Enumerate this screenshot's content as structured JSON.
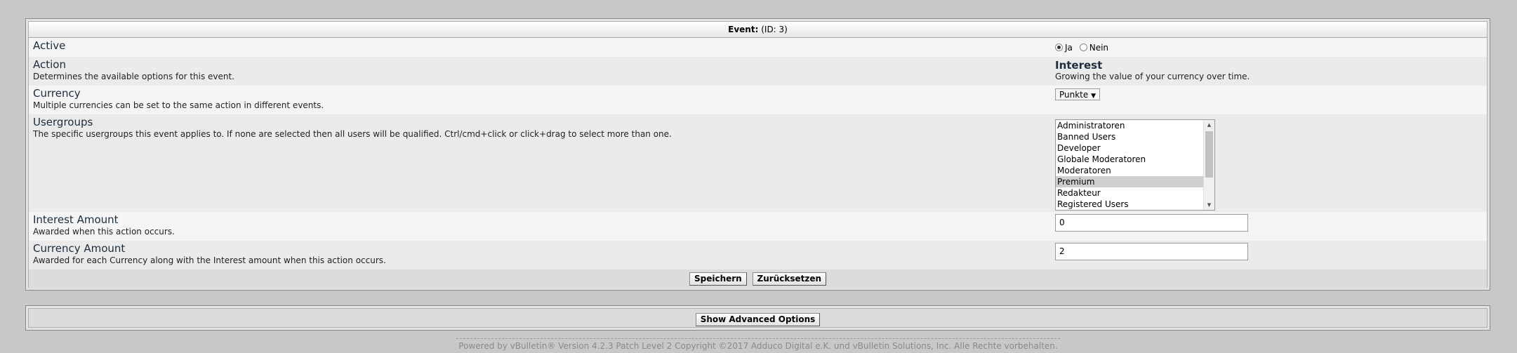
{
  "header": {
    "title_bold": "Event:",
    "title_rest": "(ID: 3)"
  },
  "rows": {
    "active": {
      "title": "Active",
      "options": [
        {
          "label": "Ja",
          "checked": true
        },
        {
          "label": "Nein",
          "checked": false
        }
      ]
    },
    "action": {
      "title": "Action",
      "desc": "Determines the available options for this event.",
      "value": "Interest",
      "value_desc": "Growing the value of your currency over time."
    },
    "currency": {
      "title": "Currency",
      "desc": "Multiple currencies can be set to the same action in different events.",
      "selected": "Punkte",
      "arrow": "▼"
    },
    "usergroups": {
      "title": "Usergroups",
      "desc": "The specific usergroups this event applies to. If none are selected then all users will be qualified. Ctrl/cmd+click or click+drag to select more than one.",
      "options": [
        {
          "label": "Administratoren",
          "selected": false
        },
        {
          "label": "Banned Users",
          "selected": false
        },
        {
          "label": "Developer",
          "selected": false
        },
        {
          "label": "Globale Moderatoren",
          "selected": false
        },
        {
          "label": "Moderatoren",
          "selected": false
        },
        {
          "label": "Premium",
          "selected": true
        },
        {
          "label": "Redakteur",
          "selected": false
        },
        {
          "label": "Registered Users",
          "selected": false
        }
      ]
    },
    "interest_amount": {
      "title": "Interest Amount",
      "desc": "Awarded when this action occurs.",
      "value": "0"
    },
    "currency_amount": {
      "title": "Currency Amount",
      "desc": "Awarded for each Currency along with the Interest amount when this action occurs.",
      "value": "2"
    }
  },
  "buttons": {
    "save": "Speichern",
    "reset": "Zurücksetzen",
    "advanced": "Show Advanced Options"
  },
  "footer": {
    "text": "Powered by vBulletin® Version 4.2.3 Patch Level 2 Copyright ©2017 Adduco Digital e.K. und vBulletin Solutions, Inc. Alle Rechte vorbehalten."
  }
}
